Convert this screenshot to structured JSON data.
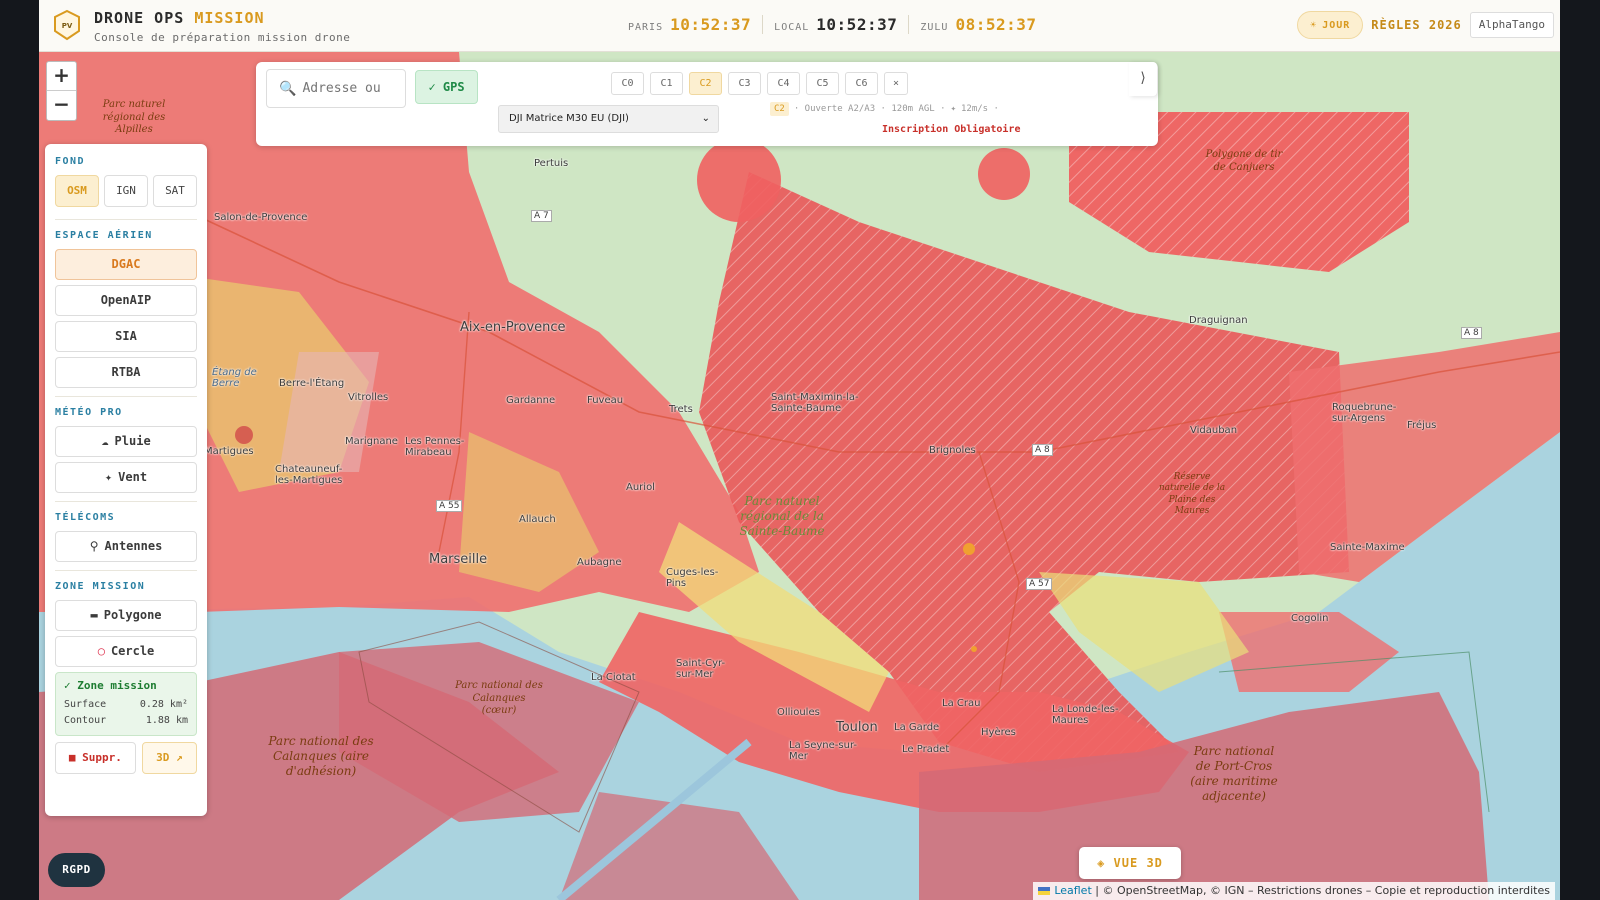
{
  "header": {
    "brand_main": "DRONE OPS",
    "brand_accent": "MISSION",
    "subtitle": "Console de préparation mission drone",
    "logo_text": "PV",
    "clocks": [
      {
        "label": "PARIS",
        "time": "10:52:37",
        "color": "#d99a1f"
      },
      {
        "label": "LOCAL",
        "time": "10:52:37",
        "color": "#2b2b2b"
      },
      {
        "label": "ZULU",
        "time": "08:52:37",
        "color": "#d99a1f"
      }
    ],
    "mode_label": "JOUR",
    "rules_label": "RÈGLES 2026",
    "user": "AlphaTango"
  },
  "controls": {
    "search_placeholder": "Adresse ou",
    "gps_label": "✓ GPS",
    "classes": [
      "C0",
      "C1",
      "C2",
      "C3",
      "C4",
      "C5",
      "C6"
    ],
    "active_class": "C2",
    "clear_label": "×",
    "drone_selected": "DJI Matrice M30 EU (DJI)",
    "info_class": "C2",
    "info_category": "· Ouverte A2/A3 · 120m AGL ·",
    "info_wind": "12m/s ·",
    "registration": "Inscription Obligatoire",
    "collapse_label": "⟩"
  },
  "zoom": {
    "in": "+",
    "out": "−"
  },
  "panel": {
    "fond_title": "FOND",
    "fond_options": [
      "OSM",
      "IGN",
      "SAT"
    ],
    "fond_active": "OSM",
    "airspace_title": "ESPACE AÉRIEN",
    "airspace_options": [
      "DGAC",
      "OpenAIP",
      "SIA",
      "RTBA"
    ],
    "airspace_active": "DGAC",
    "meteo_title": "MÉTÉO PRO",
    "meteo_options": [
      "Pluie",
      "Vent"
    ],
    "telecom_title": "TÉLÉCOMS",
    "telecom_options": [
      "Antennes"
    ],
    "mission_title": "ZONE MISSION",
    "mission_tools": [
      "Polygone",
      "Cercle"
    ],
    "zone_title": "✓ Zone mission",
    "surface_label": "Surface",
    "surface_value": "0.28 km²",
    "contour_label": "Contour",
    "contour_value": "1.88 km",
    "delete_label": "Suppr.",
    "view3d_label": "3D ↗"
  },
  "map": {
    "places": [
      {
        "name": "Salon-de-Provence"
      },
      {
        "name": "Pertuis"
      },
      {
        "name": "Aix-en-Provence"
      },
      {
        "name": "Berre-l'Étang"
      },
      {
        "name": "Vitrolles"
      },
      {
        "name": "Marignane"
      },
      {
        "name": "Les Pennes-Mirabeau"
      },
      {
        "name": "Martigues"
      },
      {
        "name": "Chateauneuf-les-Martigues"
      },
      {
        "name": "Gardanne"
      },
      {
        "name": "Fuveau"
      },
      {
        "name": "Trets"
      },
      {
        "name": "Auriol"
      },
      {
        "name": "Allauch"
      },
      {
        "name": "Marseille"
      },
      {
        "name": "Aubagne"
      },
      {
        "name": "Cuges-les-Pins"
      },
      {
        "name": "La Ciotat"
      },
      {
        "name": "Saint-Cyr-sur-Mer"
      },
      {
        "name": "Ollioules"
      },
      {
        "name": "Toulon"
      },
      {
        "name": "La Garde"
      },
      {
        "name": "La Crau"
      },
      {
        "name": "La Seyne-sur-Mer"
      },
      {
        "name": "Le Pradet"
      },
      {
        "name": "Hyères"
      },
      {
        "name": "La Londe-les-Maures"
      },
      {
        "name": "Saint-Maximin-la-Sainte-Baume"
      },
      {
        "name": "Brignoles"
      },
      {
        "name": "Draguignan"
      },
      {
        "name": "Vidauban"
      },
      {
        "name": "Roquebrune-sur-Argens"
      },
      {
        "name": "Fréjus"
      },
      {
        "name": "Sainte-Maxime"
      },
      {
        "name": "Cogolin"
      },
      {
        "name": "Étang de Berre"
      }
    ],
    "parks": [
      {
        "name": "Parc naturel régional des Alpilles"
      },
      {
        "name": "Polygone de tir de Canjuers"
      },
      {
        "name": "Parc naturel régional de la Sainte-Baume"
      },
      {
        "name": "Parc national des Calanques (cœur)"
      },
      {
        "name": "Parc national des Calanques (aire d'adhésion)"
      },
      {
        "name": "Parc national de Port-Cros (aire maritime adjacente)"
      },
      {
        "name": "Réserve naturelle de la Plaine des Maures"
      }
    ],
    "roads": [
      "A 7",
      "A 8",
      "A 8",
      "A 57",
      "A 55"
    ]
  },
  "footer": {
    "vue3d": "◈ VUE 3D",
    "rgpd": "RGPD",
    "attribution_link": "Leaflet",
    "attribution_text": " | © OpenStreetMap, © IGN – Restrictions drones – Copie et reproduction interdites"
  }
}
